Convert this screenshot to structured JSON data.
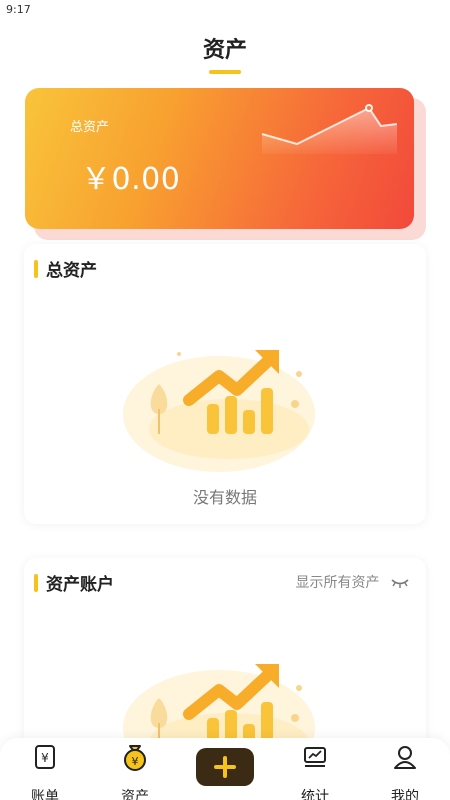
{
  "status_bar": {
    "time": "9:17"
  },
  "header": {
    "title": "资产"
  },
  "summary": {
    "label": "总资产",
    "value": "￥0.00"
  },
  "sections": {
    "total": {
      "title": "总资产",
      "empty_text": "没有数据"
    },
    "accounts": {
      "title": "资产账户",
      "show_all_label": "显示所有资产"
    }
  },
  "bottom_nav": {
    "items": [
      {
        "label": "账单",
        "icon": "bill-icon"
      },
      {
        "label": "资产",
        "icon": "money-bag-icon",
        "active": true
      },
      {
        "label": "",
        "icon": "plus-icon"
      },
      {
        "label": "统计",
        "icon": "chart-icon"
      },
      {
        "label": "我的",
        "icon": "user-icon"
      }
    ]
  },
  "colors": {
    "accent": "#f6c21c",
    "card_start": "#f9c43a",
    "card_end": "#f2493b",
    "add_button": "#3b2b14"
  }
}
